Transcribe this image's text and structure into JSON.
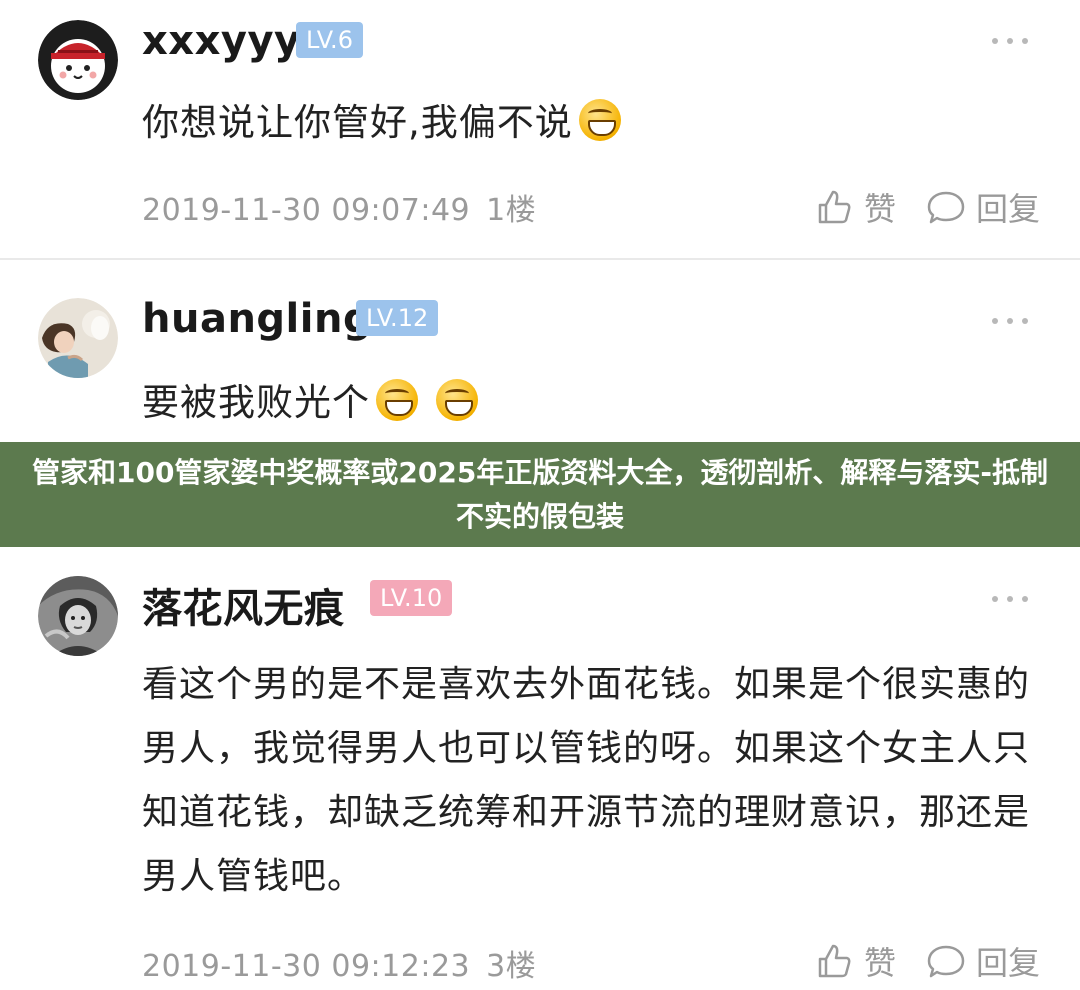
{
  "comments": [
    {
      "username": "xxxyyy",
      "level": "LV.6",
      "text": "你想说让你管好,我偏不说",
      "time": "2019-11-30 09:07:49",
      "floor": "1楼",
      "like_label": "赞",
      "reply_label": "回复",
      "emoji_count": 1,
      "badge_color": "#9cc3ec"
    },
    {
      "username": "huangling",
      "level": "LV.12",
      "text": "要被我败光个",
      "emoji_count": 2,
      "badge_color": "#9cc3ec"
    },
    {
      "username": "落花风无痕",
      "level": "LV.10",
      "text": "看这个男的是不是喜欢去外面花钱。如果是个很实惠的男人，我觉得男人也可以管钱的呀。如果这个女主人只知道花钱，却缺乏统筹和开源节流的理财意识，那还是男人管钱吧。",
      "time": "2019-11-30 09:12:23",
      "floor": "3楼",
      "like_label": "赞",
      "reply_label": "回复",
      "badge_color": "#f4a8b8"
    }
  ],
  "banner": {
    "text": "管家和100管家婆中奖概率或2025年正版资料大全，透彻剖析、解释与落实-抵制不实的假包装",
    "background": "#5c7a4e"
  },
  "icons": [
    "avatar",
    "more-icon",
    "thumb-up-icon",
    "comment-bubble-icon",
    "grin-emoji-icon"
  ]
}
